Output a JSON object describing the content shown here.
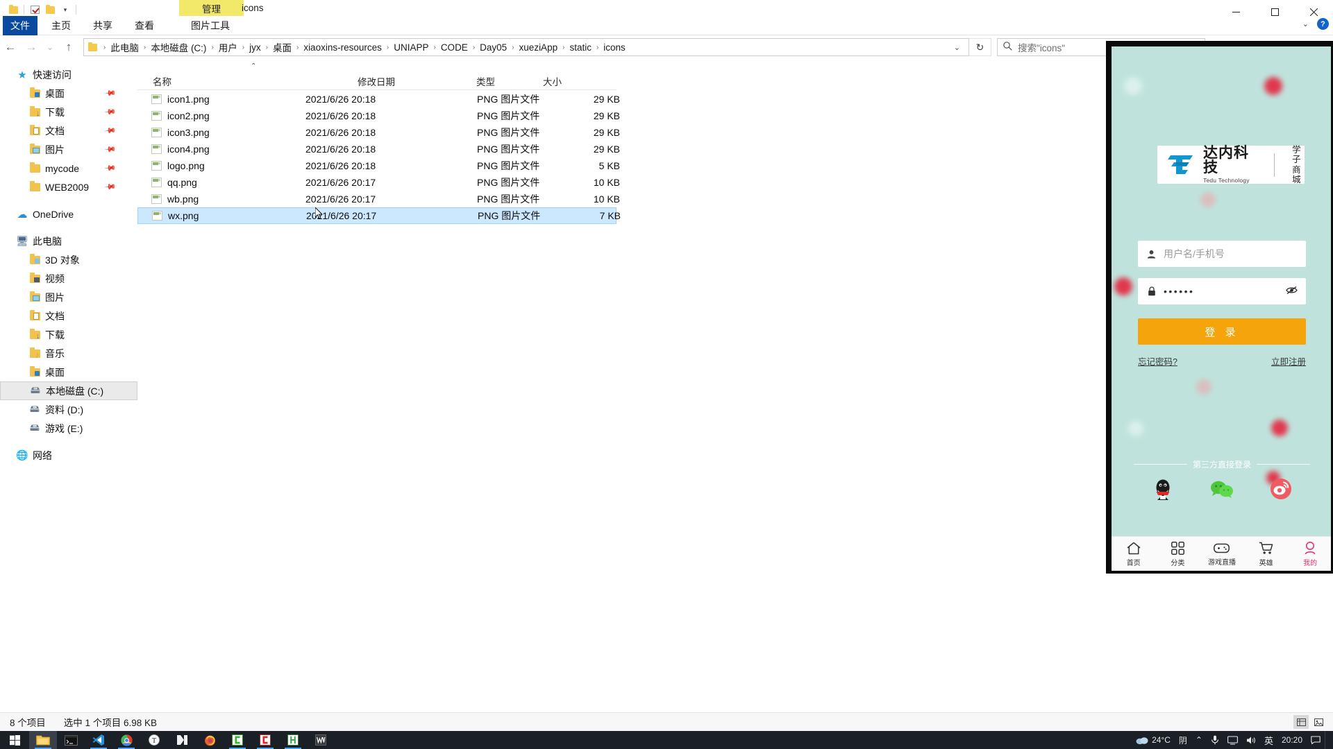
{
  "window": {
    "contextual_tab": "管理",
    "title": "icons",
    "minimize": "minimize-icon",
    "maximize": "maximize-icon",
    "close": "close-icon",
    "help": "?"
  },
  "ribbon": {
    "tabs": [
      {
        "label": "文件",
        "id": "file"
      },
      {
        "label": "主页",
        "id": "home"
      },
      {
        "label": "共享",
        "id": "share"
      },
      {
        "label": "查看",
        "id": "view"
      },
      {
        "label": "图片工具",
        "id": "picture-tools"
      }
    ]
  },
  "address": {
    "back": "←",
    "forward": "→",
    "recent": "⌄",
    "up": "↑",
    "crumbs": [
      "此电脑",
      "本地磁盘 (C:)",
      "用户",
      "jyx",
      "桌面",
      "xiaoxins-resources",
      "UNIAPP",
      "CODE",
      "Day05",
      "xueziApp",
      "static",
      "icons"
    ],
    "dropdown_caret": "⌄",
    "refresh": "↻"
  },
  "search": {
    "placeholder": "搜索\"icons\"",
    "icon": "search-icon"
  },
  "sidebar": {
    "groups": [
      {
        "root": {
          "label": "快速访问",
          "icon": "star-icon",
          "level": 0
        },
        "items": [
          {
            "label": "桌面",
            "icon": "folder-desktop-icon",
            "pinned": true
          },
          {
            "label": "下载",
            "icon": "folder-downloads-icon",
            "pinned": true
          },
          {
            "label": "文档",
            "icon": "folder-documents-icon",
            "pinned": true
          },
          {
            "label": "图片",
            "icon": "folder-pictures-icon",
            "pinned": true
          },
          {
            "label": "mycode",
            "icon": "folder-icon",
            "pinned": true
          },
          {
            "label": "WEB2009",
            "icon": "folder-icon",
            "pinned": true
          }
        ]
      },
      {
        "root": {
          "label": "OneDrive",
          "icon": "cloud-icon",
          "level": 0
        },
        "items": []
      },
      {
        "root": {
          "label": "此电脑",
          "icon": "this-pc-icon",
          "level": 0
        },
        "items": [
          {
            "label": "3D 对象",
            "icon": "folder-3d-icon",
            "pinned": false
          },
          {
            "label": "视频",
            "icon": "folder-videos-icon",
            "pinned": false
          },
          {
            "label": "图片",
            "icon": "folder-pictures-icon",
            "pinned": false
          },
          {
            "label": "文档",
            "icon": "folder-documents-icon",
            "pinned": false
          },
          {
            "label": "下载",
            "icon": "folder-downloads-icon",
            "pinned": false
          },
          {
            "label": "音乐",
            "icon": "folder-music-icon",
            "pinned": false
          },
          {
            "label": "桌面",
            "icon": "folder-desktop-icon",
            "pinned": false
          },
          {
            "label": "本地磁盘 (C:)",
            "icon": "drive-system-icon",
            "pinned": false,
            "selected": true
          },
          {
            "label": "资料 (D:)",
            "icon": "drive-icon",
            "pinned": false
          },
          {
            "label": "游戏 (E:)",
            "icon": "drive-icon",
            "pinned": false
          }
        ]
      },
      {
        "root": {
          "label": "网络",
          "icon": "network-icon",
          "level": 0
        },
        "items": []
      }
    ]
  },
  "filelist": {
    "columns": [
      "名称",
      "修改日期",
      "类型",
      "大小"
    ],
    "rows": [
      {
        "name": "icon1.png",
        "date": "2021/6/26 20:18",
        "type": "PNG 图片文件",
        "size": "29 KB",
        "selected": false
      },
      {
        "name": "icon2.png",
        "date": "2021/6/26 20:18",
        "type": "PNG 图片文件",
        "size": "29 KB",
        "selected": false
      },
      {
        "name": "icon3.png",
        "date": "2021/6/26 20:18",
        "type": "PNG 图片文件",
        "size": "29 KB",
        "selected": false
      },
      {
        "name": "icon4.png",
        "date": "2021/6/26 20:18",
        "type": "PNG 图片文件",
        "size": "29 KB",
        "selected": false
      },
      {
        "name": "logo.png",
        "date": "2021/6/26 20:18",
        "type": "PNG 图片文件",
        "size": "5 KB",
        "selected": false
      },
      {
        "name": "qq.png",
        "date": "2021/6/26 20:17",
        "type": "PNG 图片文件",
        "size": "10 KB",
        "selected": false
      },
      {
        "name": "wb.png",
        "date": "2021/6/26 20:17",
        "type": "PNG 图片文件",
        "size": "10 KB",
        "selected": false
      },
      {
        "name": "wx.png",
        "date": "2021/6/26 20:17",
        "type": "PNG 图片文件",
        "size": "7 KB",
        "selected": true
      }
    ]
  },
  "status": {
    "count": "8 个项目",
    "selection": "选中 1 个项目  6.98 KB"
  },
  "phone": {
    "brand": {
      "name_cn": "达内科技",
      "name_en": "Tedu Technology",
      "sub_line1": "学子",
      "sub_line2": "商城"
    },
    "username": {
      "placeholder": "用户名/手机号",
      "icon": "user-icon"
    },
    "password": {
      "value": "••••••",
      "icon": "lock-icon",
      "toggle_icon": "eye-off-icon"
    },
    "login_button": "登 录",
    "forgot_link": "忘记密码?",
    "register_link": "立即注册",
    "third_party_label": "第三方直接登录",
    "socials": [
      {
        "name": "qq-icon",
        "label": "QQ"
      },
      {
        "name": "wechat-icon",
        "label": "WeChat"
      },
      {
        "name": "weibo-icon",
        "label": "Weibo"
      }
    ],
    "tabs": [
      {
        "label": "首页",
        "icon": "home-icon",
        "active": false
      },
      {
        "label": "分类",
        "icon": "grid-icon",
        "active": false
      },
      {
        "label": "游戏直播",
        "icon": "gamepad-icon",
        "active": false
      },
      {
        "label": "英雄",
        "icon": "cart-icon",
        "active": false
      },
      {
        "label": "我的",
        "icon": "user-profile-icon",
        "active": true
      }
    ],
    "accent_color": "#f5a40b",
    "active_tab_color": "#e8336d",
    "background_color": "#bfe3dc"
  },
  "taskbar": {
    "start": "windows-logo-icon",
    "apps": [
      {
        "name": "file-explorer-icon",
        "active": true
      },
      {
        "name": "terminal-icon",
        "active": false
      },
      {
        "name": "vscode-icon",
        "active": false
      },
      {
        "name": "chrome-icon",
        "active": false
      },
      {
        "name": "typora-icon",
        "active": false
      },
      {
        "name": "hbuilder-icon",
        "active": false
      },
      {
        "name": "firefox-icon",
        "active": false
      },
      {
        "name": "chrome-green-icon",
        "active": false
      },
      {
        "name": "clion-icon",
        "active": false
      },
      {
        "name": "hbuilderx-icon",
        "active": false
      },
      {
        "name": "wps-writer-icon",
        "active": false
      }
    ],
    "tray": {
      "weather_icon": "cloud-icon",
      "temperature": "24°C",
      "condition": "阴",
      "chevron": "⌃",
      "mic_icon": "microphone-icon",
      "network_icon": "network-tray-icon",
      "volume_icon": "volume-icon",
      "ime": "英",
      "clock": "20:20",
      "notifications_icon": "notification-icon"
    }
  }
}
